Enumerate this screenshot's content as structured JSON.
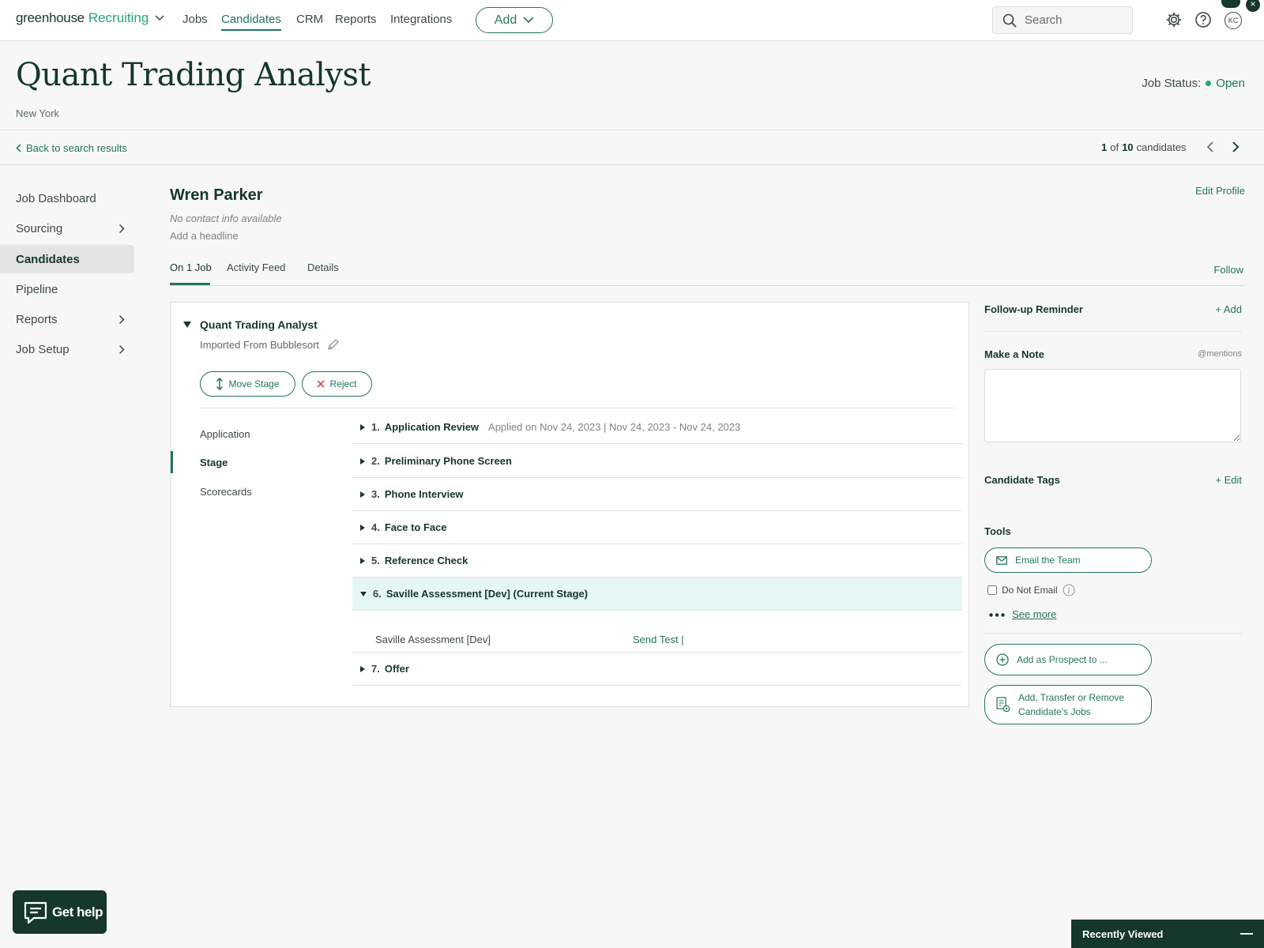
{
  "nav": {
    "brand_main": "greenhouse",
    "brand_sub": "Recruiting",
    "links": [
      "Jobs",
      "Candidates",
      "CRM",
      "Reports",
      "Integrations"
    ],
    "active": "Candidates",
    "add_label": "Add",
    "search_placeholder": "Search",
    "avatar_initials": "KC",
    "more_glyph": "•••",
    "close_glyph": "×"
  },
  "job": {
    "title": "Quant Trading Analyst",
    "location": "New York",
    "status_label": "Job Status:",
    "status_value": "Open"
  },
  "nav_bar": {
    "back_label": "Back to search results",
    "counter_index": "1",
    "counter_of": "of",
    "counter_total": "10",
    "counter_suffix": "candidates"
  },
  "sidebar": {
    "items": [
      {
        "label": "Job Dashboard",
        "chevron": false,
        "active": false
      },
      {
        "label": "Sourcing",
        "chevron": true,
        "active": false
      },
      {
        "label": "Candidates",
        "chevron": false,
        "active": true
      },
      {
        "label": "Pipeline",
        "chevron": false,
        "active": false
      },
      {
        "label": "Reports",
        "chevron": true,
        "active": false
      },
      {
        "label": "Job Setup",
        "chevron": true,
        "active": false
      }
    ]
  },
  "candidate": {
    "name": "Wren Parker",
    "contact": "No contact info available",
    "headline": "Add a headline",
    "edit_profile": "Edit Profile",
    "tabs": [
      "On 1 Job",
      "Activity Feed",
      "Details"
    ],
    "active_tab": "On 1 Job",
    "follow": "Follow"
  },
  "application": {
    "job_title": "Quant Trading Analyst",
    "source": "Imported From Bubblesort",
    "move_stage": "Move Stage",
    "reject": "Reject",
    "subnav": [
      "Application",
      "Stage",
      "Scorecards"
    ],
    "active_subnav": "Stage",
    "stages": [
      {
        "num": "1.",
        "name": "Application Review",
        "meta": "Applied on Nov 24, 2023 | Nov 24, 2023 - Nov 24, 2023",
        "expanded": false,
        "current": false
      },
      {
        "num": "2.",
        "name": "Preliminary Phone Screen",
        "meta": "",
        "expanded": false,
        "current": false
      },
      {
        "num": "3.",
        "name": "Phone Interview",
        "meta": "",
        "expanded": false,
        "current": false
      },
      {
        "num": "4.",
        "name": "Face to Face",
        "meta": "",
        "expanded": false,
        "current": false
      },
      {
        "num": "5.",
        "name": "Reference Check",
        "meta": "",
        "expanded": false,
        "current": false
      },
      {
        "num": "6.",
        "name": "Saville Assessment [Dev] (Current Stage)",
        "meta": "",
        "expanded": true,
        "current": true
      },
      {
        "num": "7.",
        "name": "Offer",
        "meta": "",
        "expanded": false,
        "current": false
      }
    ],
    "sub_item": {
      "name": "Saville Assessment [Dev]",
      "action": "Send Test |"
    }
  },
  "right_panel": {
    "reminder_title": "Follow-up Reminder",
    "reminder_action": "+ Add",
    "note_title": "Make a Note",
    "note_hint": "@mentions",
    "tags_title": "Candidate Tags",
    "tags_action": "+ Edit",
    "tools_title": "Tools",
    "email_team": "Email the Team",
    "do_not_email": "Do Not Email",
    "do_not_email_checked": false,
    "see_more": "See more",
    "add_prospect": "Add as Prospect to ...",
    "transfer": "Add, Transfer or Remove Candidate's Jobs"
  },
  "widgets": {
    "get_help": "Get help",
    "recently_viewed": "Recently Viewed"
  },
  "colors": {
    "brand_green": "#24735f",
    "accent_green": "#24a47f",
    "dark": "#15372c",
    "current_stage_bg": "#e5f7f2"
  }
}
